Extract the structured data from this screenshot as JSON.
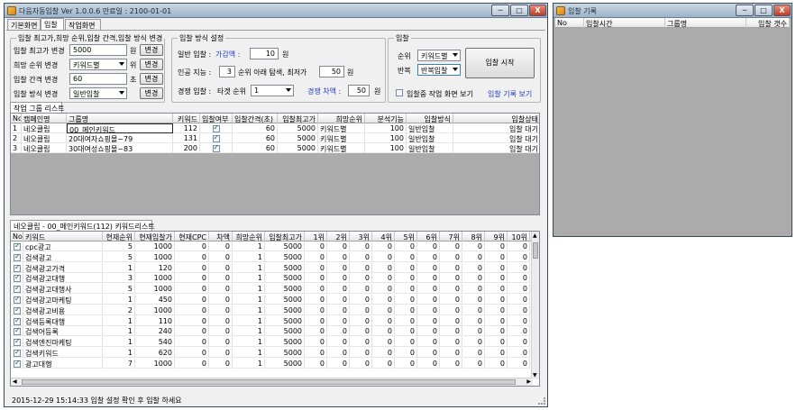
{
  "main_window": {
    "title": "다음자동입찰 Ver 1.0.0.6 만료일 : 2100-01-01",
    "min": "─",
    "max": "□",
    "close": "X"
  },
  "tabs": [
    "기본화면",
    "입찰",
    "작업화면"
  ],
  "group1": {
    "title": "입찰 최고가,희망 순위,입찰 간격,입찰 방식 변경",
    "rows": [
      {
        "label": "입찰 최고가 변경",
        "value": "5000",
        "unit": "원",
        "button": "변경"
      },
      {
        "label": "희망 순위 변경",
        "value": "키워드별",
        "unit": "위",
        "button": "변경"
      },
      {
        "label": "입찰 간격 변경",
        "value": "60",
        "unit": "초",
        "button": "변경"
      },
      {
        "label": "입찰 방식 변경",
        "value": "일반입찰",
        "unit": "",
        "button": "변경"
      }
    ]
  },
  "group2": {
    "title": "입찰 방식 설정",
    "general_label": "일반 입찰 :",
    "general_sub": "가감액 :",
    "general_value": "10",
    "general_unit": "원",
    "smart_label": "인공 지능 :",
    "smart_value1": "3",
    "smart_text1": "순위 아래 탐색, 최저가",
    "smart_value2": "50",
    "smart_unit": "원",
    "compete_label": "경쟁 입찰 :",
    "compete_text": "타겟 순위",
    "compete_select": "1",
    "compete_sub": "경쟁 차액 :",
    "compete_value": "50",
    "compete_unit": "원"
  },
  "group3": {
    "title": "입찰",
    "rank_label": "순위",
    "rank_select": "키워드별",
    "repeat_label": "반복",
    "repeat_select": "반복입찰",
    "start_button": "입찰 시작",
    "show_check": "입찰중 작업 화면 보기",
    "history_link": "입찰 기록 보기"
  },
  "group_list": {
    "tab": "작업 그룹 리스트",
    "columns": [
      "No",
      "캠페인명",
      "그룹명",
      "키워드",
      "입찰여부",
      "입찰간격(초)",
      "입찰최고가",
      "희망순위",
      "분석기능",
      "입찰방식",
      "입찰상태"
    ],
    "rows": [
      [
        "1",
        "네오클립",
        "00_메인키워드",
        "112",
        true,
        "60",
        "5000",
        "키워드별",
        "100",
        "일반입찰",
        "입찰 대기"
      ],
      [
        "2",
        "네오클립",
        "20대여자쇼핑몰~79",
        "131",
        true,
        "60",
        "5000",
        "키워드별",
        "100",
        "일반입찰",
        "입찰 대기"
      ],
      [
        "3",
        "네오클립",
        "30대여성쇼핑몰~83",
        "200",
        true,
        "60",
        "5000",
        "키워드별",
        "100",
        "일반입찰",
        "입찰 대기"
      ]
    ]
  },
  "keyword_list": {
    "tab": "네오클립 - 00_메인키워드(112) 키워드리스트",
    "columns": [
      "No",
      "키워드",
      "현재순위",
      "현재입찰가",
      "현재CPC",
      "차액",
      "희망순위",
      "입찰최고가",
      "1위",
      "2위",
      "3위",
      "4위",
      "5위",
      "6위",
      "7위",
      "8위",
      "9위",
      "10위"
    ],
    "rows": [
      {
        "kw": "cpc광고",
        "rank": "5",
        "bid": "1000",
        "cpc": "0",
        "diff": "0",
        "hope": "1",
        "max": "5000"
      },
      {
        "kw": "검색광고",
        "rank": "5",
        "bid": "1000",
        "cpc": "0",
        "diff": "0",
        "hope": "1",
        "max": "5000"
      },
      {
        "kw": "검색광고가격",
        "rank": "1",
        "bid": "120",
        "cpc": "0",
        "diff": "0",
        "hope": "1",
        "max": "5000"
      },
      {
        "kw": "검색광고대행",
        "rank": "3",
        "bid": "1000",
        "cpc": "0",
        "diff": "0",
        "hope": "1",
        "max": "5000"
      },
      {
        "kw": "검색광고대행사",
        "rank": "5",
        "bid": "1000",
        "cpc": "0",
        "diff": "0",
        "hope": "1",
        "max": "5000"
      },
      {
        "kw": "검색광고마케팅",
        "rank": "1",
        "bid": "450",
        "cpc": "0",
        "diff": "0",
        "hope": "1",
        "max": "5000"
      },
      {
        "kw": "검색광고비용",
        "rank": "2",
        "bid": "1000",
        "cpc": "0",
        "diff": "0",
        "hope": "1",
        "max": "5000"
      },
      {
        "kw": "검색등록대행",
        "rank": "1",
        "bid": "110",
        "cpc": "0",
        "diff": "0",
        "hope": "1",
        "max": "5000"
      },
      {
        "kw": "검색어등록",
        "rank": "1",
        "bid": "240",
        "cpc": "0",
        "diff": "0",
        "hope": "1",
        "max": "5000"
      },
      {
        "kw": "검색엔진마케팅",
        "rank": "1",
        "bid": "540",
        "cpc": "0",
        "diff": "0",
        "hope": "1",
        "max": "5000"
      },
      {
        "kw": "검색키워드",
        "rank": "1",
        "bid": "620",
        "cpc": "0",
        "diff": "0",
        "hope": "1",
        "max": "5000"
      },
      {
        "kw": "광고대행",
        "rank": "7",
        "bid": "1000",
        "cpc": "0",
        "diff": "0",
        "hope": "1",
        "max": "5000"
      }
    ],
    "rank_zero": "0"
  },
  "status_text": "2015-12-29 15:14:33 입찰 설정 확인 후 입찰 하세요",
  "history_window": {
    "title": "입찰 기록",
    "columns": [
      "No",
      "입찰시간",
      "그룹명",
      "입찰 갯수"
    ],
    "min": "─",
    "max": "□",
    "close": "X"
  }
}
